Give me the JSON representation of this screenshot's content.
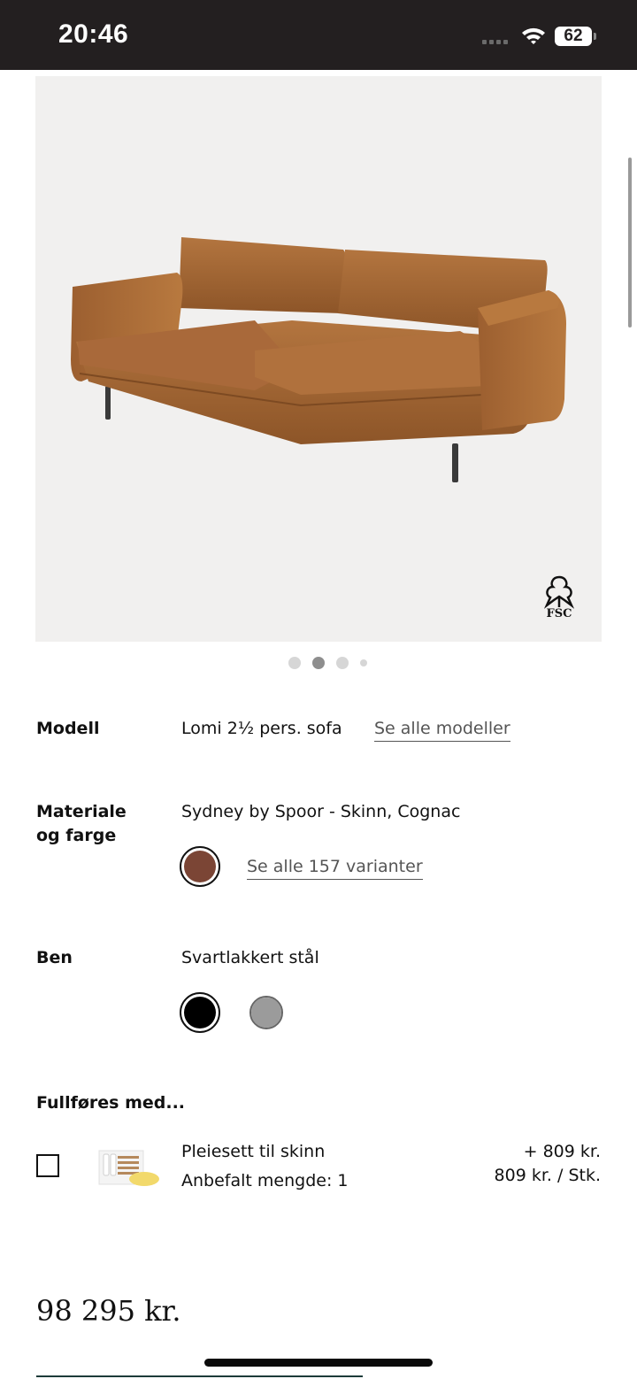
{
  "status_bar": {
    "time": "20:46",
    "battery": "62"
  },
  "product": {
    "image_badge_icon": "fsc-tree-icon",
    "image_badge_text": "FSC",
    "carousel": {
      "count": 4,
      "active_index": 1
    }
  },
  "model": {
    "label": "Modell",
    "value": "Lomi 2½ pers. sofa",
    "link": "Se alle modeller"
  },
  "material": {
    "label_line1": "Materiale",
    "label_line2": "og farge",
    "value": "Sydney by Spoor - Skinn, Cognac",
    "swatch_color": "#7b4535",
    "link": "Se alle 157 varianter"
  },
  "legs": {
    "label": "Ben",
    "value": "Svartlakkert stål",
    "options": [
      {
        "name": "black",
        "color": "#000000",
        "selected": true
      },
      {
        "name": "grey",
        "color": "#9b9b9b",
        "selected": false
      }
    ]
  },
  "addons": {
    "heading": "Fullføres med...",
    "items": [
      {
        "name": "Pleiesett til skinn",
        "quantity": "Anbefalt mengde: 1",
        "price_add": "+ 809 kr.",
        "unit_price": "809 kr. / Stk.",
        "checked": false
      }
    ]
  },
  "total": {
    "price": "98 295 kr."
  },
  "colors": {
    "status_bar_bg": "#231f20",
    "image_bg": "#f1f0ef",
    "leather": "#a5683a",
    "accent_rule": "#1d3b3a"
  }
}
